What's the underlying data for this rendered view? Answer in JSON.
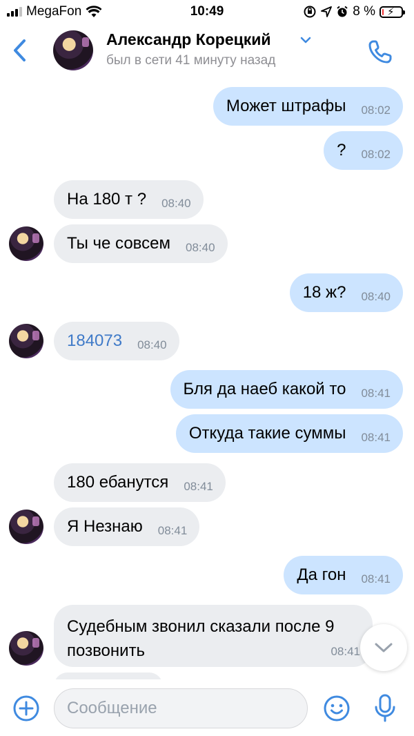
{
  "status_bar": {
    "carrier": "MegaFon",
    "time": "10:49",
    "battery_percent": "8 %",
    "battery_level": 0.08
  },
  "header": {
    "contact_name": "Александр Корецкий",
    "contact_status": "был в сети 41 минуту назад",
    "icons": [
      "back-chevron-icon",
      "avatar",
      "chevron-down-icon",
      "phone-icon"
    ]
  },
  "messages": [
    {
      "dir": "out",
      "text": "Может штрафы",
      "time": "08:02"
    },
    {
      "dir": "out",
      "text": "?",
      "time": "08:02"
    },
    {
      "dir": "in",
      "text": "На 180 т ?",
      "time": "08:40"
    },
    {
      "dir": "in",
      "text": "Ты че совсем",
      "time": "08:40"
    },
    {
      "dir": "out",
      "text": "18 ж?",
      "time": "08:40"
    },
    {
      "dir": "in",
      "text": "184073",
      "time": "08:40"
    },
    {
      "dir": "out",
      "text": "Бля да наеб какой то",
      "time": "08:41"
    },
    {
      "dir": "out",
      "text": "Откуда такие суммы",
      "time": "08:41"
    },
    {
      "dir": "in",
      "text": "180 ебанутся",
      "time": "08:41"
    },
    {
      "dir": "in",
      "text": "Я Незнаю",
      "time": "08:41"
    },
    {
      "dir": "out",
      "text": "Да гон",
      "time": "08:41"
    },
    {
      "dir": "in",
      "text": "Судебным звонил сказали после 9 позвонить",
      "time": "08:41"
    }
  ],
  "composer": {
    "placeholder": "Сообщение"
  },
  "colors": {
    "accent": "#3f8ae0",
    "outgoing_bubble": "#cce4ff",
    "incoming_bubble": "#ebedf0",
    "link": "#3f7ac8"
  }
}
